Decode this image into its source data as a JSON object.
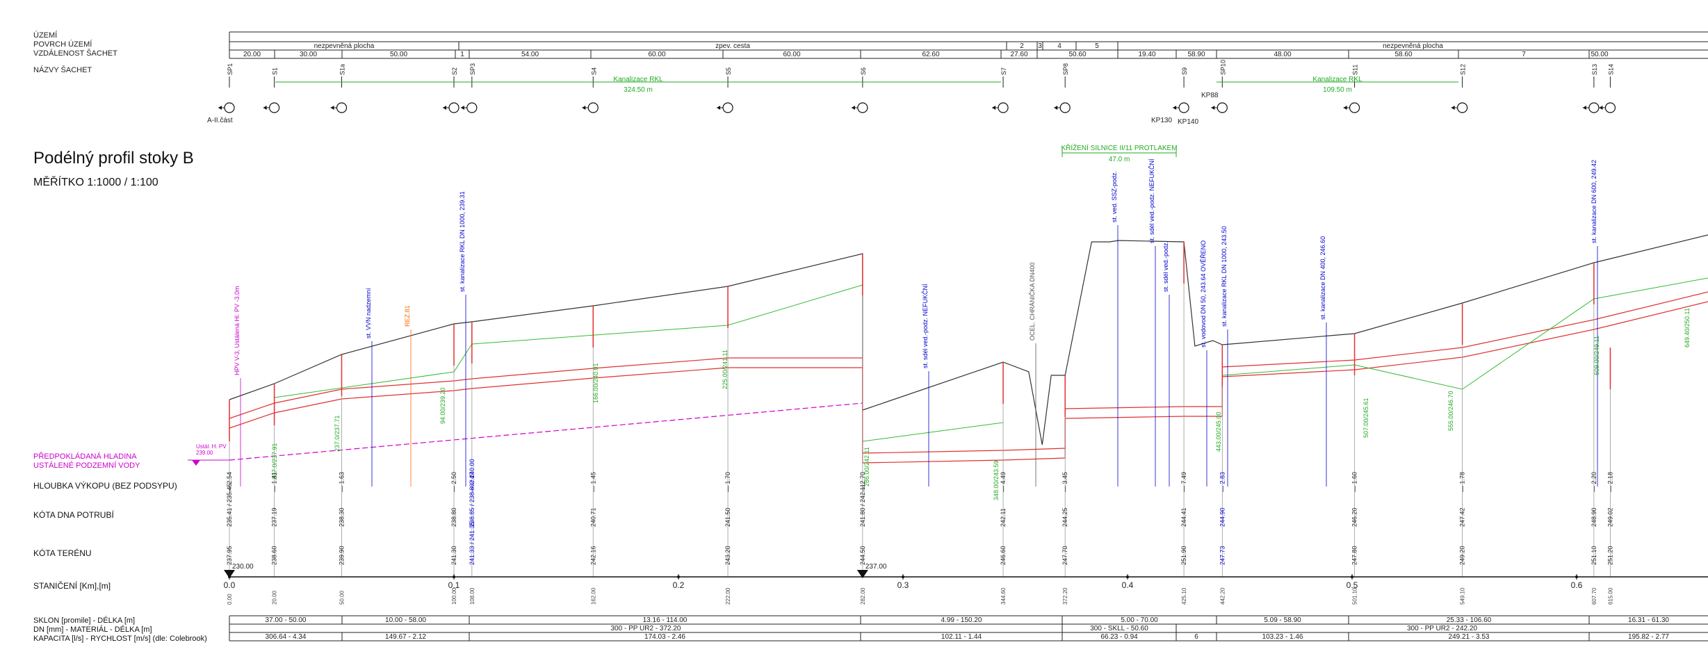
{
  "header_labels": {
    "uzemi": "ÚZEMÍ",
    "povrch": "POVRCH ÚZEMÍ",
    "vzdalenost": "VZDÁLENOST ŠACHET",
    "nazvy": "NÁZVY ŠACHET"
  },
  "title": "Podélný profil stoky B",
  "scale": "MĚŘÍTKO 1:1000 / 1:100",
  "water_level_label": [
    "PŘEDPOKLÁDANÁ HLADINA",
    "USTÁLENÉ PODZEMNÍ VODY"
  ],
  "water_level_note": [
    "Ustál. H. PV",
    "239.00"
  ],
  "row_labels": {
    "hloubka": "HLOUBKA VÝKOPU (BEZ PODSYPU)",
    "kota_dna": "KÓTA DNA POTRUBÍ",
    "kota_terenu": "KÓTA TERÉNU",
    "staniceni": "STANIČENÍ [Km],[m]"
  },
  "footer_labels": {
    "sklon": "SKLON [promile] - DÉLKA [m]",
    "dn": "DN [mm] - MATERIÁL - DÉLKA [m]",
    "kapacita": "KAPACITA [l/s] - RYCHLOST [m/s] (dle: Colebrook)"
  },
  "surface_segments": [
    {
      "label": "nezpevněná plocha"
    },
    {
      "label": "zpev. cesta"
    },
    {
      "label": "2"
    },
    {
      "label": "3"
    },
    {
      "label": "4"
    },
    {
      "label": "5"
    },
    {
      "label": "nezpevněná plocha"
    }
  ],
  "distances": [
    "20.00",
    "30.00",
    "50.00",
    "1",
    "54.00",
    "60.00",
    "60.00",
    "62.60",
    "27.60",
    "50.60",
    "19.40",
    "58.90",
    "48.00",
    "58.60",
    "7",
    "50.00"
  ],
  "manholes": [
    {
      "name": "SP1",
      "depth": "2.54",
      "invert": "235.41 / 235.45",
      "terrain": "237.95",
      "station": "0.00"
    },
    {
      "name": "S1",
      "depth": "1.41",
      "invert": "237.19",
      "terrain": "238.60",
      "station": "20.00"
    },
    {
      "name": "S1a",
      "depth": "1.63",
      "invert": "238.30",
      "terrain": "239.90",
      "station": "50.00"
    },
    {
      "name": "S2",
      "depth": "2.50",
      "invert": "238.80",
      "terrain": "241.30",
      "station": "100.00"
    },
    {
      "name": "SP3",
      "depth": "2.47",
      "invert": "238.85 / 238.89 / 240.00",
      "terrain": "241.33 / 241.35",
      "station": "108.00"
    },
    {
      "name": "S4",
      "depth": "1.45",
      "invert": "240.71",
      "terrain": "242.16",
      "station": "162.00"
    },
    {
      "name": "S5",
      "depth": "1.70",
      "invert": "241.50",
      "terrain": "243.20",
      "station": "222.00"
    },
    {
      "name": "S6",
      "depth": "2.70",
      "invert": "241.80 / 242.11",
      "terrain": "244.50",
      "station": "282.00"
    },
    {
      "name": "S7",
      "depth": "4.49",
      "invert": "242.11",
      "terrain": "246.60",
      "station": "344.60"
    },
    {
      "name": "SP8",
      "depth": "3.45",
      "invert": "244.25",
      "terrain": "247.70",
      "station": "372.20"
    },
    {
      "name": "S9",
      "depth": "7.49",
      "invert": "244.41",
      "terrain": "251.90",
      "station": "425.10"
    },
    {
      "name": "SP10",
      "depth": "2.83",
      "invert": "244.90",
      "terrain": "247.73",
      "station": "442.20"
    },
    {
      "name": "S11",
      "depth": "1.60",
      "invert": "246.20",
      "terrain": "247.80",
      "station": "501.10"
    },
    {
      "name": "S12",
      "depth": "1.78",
      "invert": "247.42",
      "terrain": "249.20",
      "station": "549.10"
    },
    {
      "name": "S13",
      "depth": "2.20",
      "invert": "248.90",
      "terrain": "251.10",
      "station": "607.70"
    },
    {
      "name": "S14",
      "depth": "2.18",
      "invert": "249.02",
      "terrain": "251.20",
      "station": "615.00"
    }
  ],
  "crossings": [
    {
      "text": "HPV V-3, Ustálená Hl. PV -3.0m",
      "color": "#cc00cc"
    },
    {
      "text": "st. VVN nadzemní",
      "color": "#0000cc"
    },
    {
      "text": "REZ.81",
      "color": "#ff6600"
    },
    {
      "text": "st. kanalizace RKL DN 1000, 239.31",
      "color": "#0000cc"
    },
    {
      "text": "st. sdél ved.-podz. NEFUKČNÍ",
      "color": "#0000cc"
    },
    {
      "text": "OCEL. CHRÁNIČKA DN400",
      "color": "#555555"
    },
    {
      "text": "st. ved. SSZ-podz.",
      "color": "#0000cc"
    },
    {
      "text": "st. sdél ved.-podz. NEFUKČNÍ",
      "color": "#0000cc"
    },
    {
      "text": "st. sdél ved.-podz.",
      "color": "#0000cc"
    },
    {
      "text": "st. vodovod DN 50, 243.64 OVĚŘENO",
      "color": "#0000cc"
    },
    {
      "text": "st. kanalizace RKL DN 1000, 243.50",
      "color": "#0000cc"
    },
    {
      "text": "st. kanalizace DN 400, 246.60",
      "color": "#0000cc"
    },
    {
      "text": "st. kanalizace DN 600, 249.42",
      "color": "#0000cc"
    }
  ],
  "green_values": [
    "237.0/237.91",
    "237.0/237.71",
    "94.00/239.20",
    "166.00/240.01",
    "225.00/241.11",
    "348.00/243.59",
    "286.00/242.11",
    "443.00/245.00",
    "507.00/245.61",
    "555.00/246.70",
    "609.00/249.11",
    "649.40/250.11"
  ],
  "red_value": "REZ.81",
  "station_ticks": [
    "0.0",
    "0.1",
    "0.2",
    "0.3",
    "0.4",
    "0.5",
    "0.6"
  ],
  "terrain_marks": [
    "230.00",
    "237.00"
  ],
  "rkl_labels": [
    {
      "name": "Kanalizace RKL",
      "length": "324.50 m"
    },
    {
      "name": "Kanalizace RKL",
      "length": "109.50 m"
    }
  ],
  "crossing_span": {
    "label": "KŘÍŽENÍ SILNICE II/11 PROTLAKEM",
    "length": "47.0 m"
  },
  "misc_labels": {
    "aiicast": "A-II.část",
    "kp130": "KP130",
    "kp140": "KP140",
    "kp88": "KP88"
  },
  "sklon": [
    "37.00 - 50.00",
    "10.00 - 58.00",
    "13.16 - 114.00",
    "4.99 - 150.20",
    "5.00 - 70.00",
    "5.09 - 58.90",
    "25.33 - 106.60",
    "16.31 - 61.30"
  ],
  "dn": [
    "300 - PP UR2 - 372.20",
    "300 - SKLL - 50.60",
    "300 - PP UR2 - 242.20"
  ],
  "kapacita": [
    "306.64 - 4.34",
    "149.67 - 2.12",
    "174.03 - 2.46",
    "102.11 - 1.44",
    "66.23 - 0.94",
    "6",
    "103.23 - 1.46",
    "249.21 - 3.53",
    "195.82 - 2.77"
  ],
  "chart_data": {
    "type": "line",
    "xlabel": "STANIČENÍ [Km],[m]",
    "ylabel": "",
    "x_station_m": [
      0,
      20,
      50,
      100,
      108,
      162,
      222,
      282,
      344.6,
      372.2,
      425.1,
      442.2,
      501.1,
      549.1,
      607.7,
      615
    ],
    "series": [
      {
        "name": "KÓTA TERÉNU",
        "values": [
          237.95,
          238.6,
          239.9,
          241.3,
          241.35,
          242.16,
          243.2,
          244.5,
          246.6,
          247.7,
          251.9,
          247.73,
          247.8,
          249.2,
          251.1,
          251.2
        ]
      },
      {
        "name": "KÓTA DNA POTRUBÍ",
        "values": [
          235.41,
          237.19,
          238.3,
          238.8,
          238.89,
          240.71,
          241.5,
          241.8,
          242.11,
          244.25,
          244.41,
          244.9,
          246.2,
          247.42,
          248.9,
          249.02
        ]
      }
    ]
  }
}
